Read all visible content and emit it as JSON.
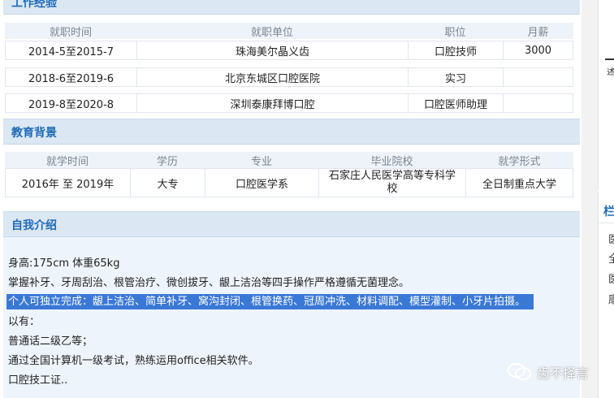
{
  "work": {
    "title": "工作经验",
    "headers": [
      "就职时间",
      "就职单位",
      "职位",
      "月薪"
    ],
    "rows": [
      {
        "time": "2014-5至2015-7",
        "company": "珠海美尔晶义齿",
        "position": "口腔技师",
        "salary": "3000"
      },
      {
        "time": "2018-6至2019-6",
        "company": "北京东城区口腔医院",
        "position": "实习",
        "salary": ""
      },
      {
        "time": "2019-8至2020-8",
        "company": "深圳泰康拜博口腔",
        "position": "口腔医师助理",
        "salary": ""
      }
    ]
  },
  "education": {
    "title": "教育背景",
    "headers": [
      "就学时间",
      "学历",
      "专业",
      "毕业院校",
      "就学形式"
    ],
    "row": {
      "time": "2016年 至 2019年",
      "degree": "大专",
      "major": "口腔医学系",
      "school_line1": "石家庄人民医学高等专科学",
      "school_line2": "校",
      "form": "全日制重点大学"
    }
  },
  "intro": {
    "title": "自我介绍",
    "lines": [
      "身高:175cm 体重65kg",
      "掌握补牙、牙周刮治、根管治疗、微创拔牙、龈上洁治等四手操作严格遵循无菌理念。",
      "个人可独立完成：龈上洁治、简单补牙、窝沟封闭、根管换药、冠周冲洗、材料调配、模型灌制、小牙片拍摄。",
      "以有：",
      "普通话二级乙等；",
      "通过全国计算机一级考试，熟练运用office相关软件。",
      "口腔技工证.."
    ]
  },
  "sidebar": {
    "top_text": "述",
    "box_title": "栏",
    "items": [
      "医",
      "全",
      "医",
      "康"
    ]
  },
  "watermark": {
    "text": "齿不择言"
  }
}
